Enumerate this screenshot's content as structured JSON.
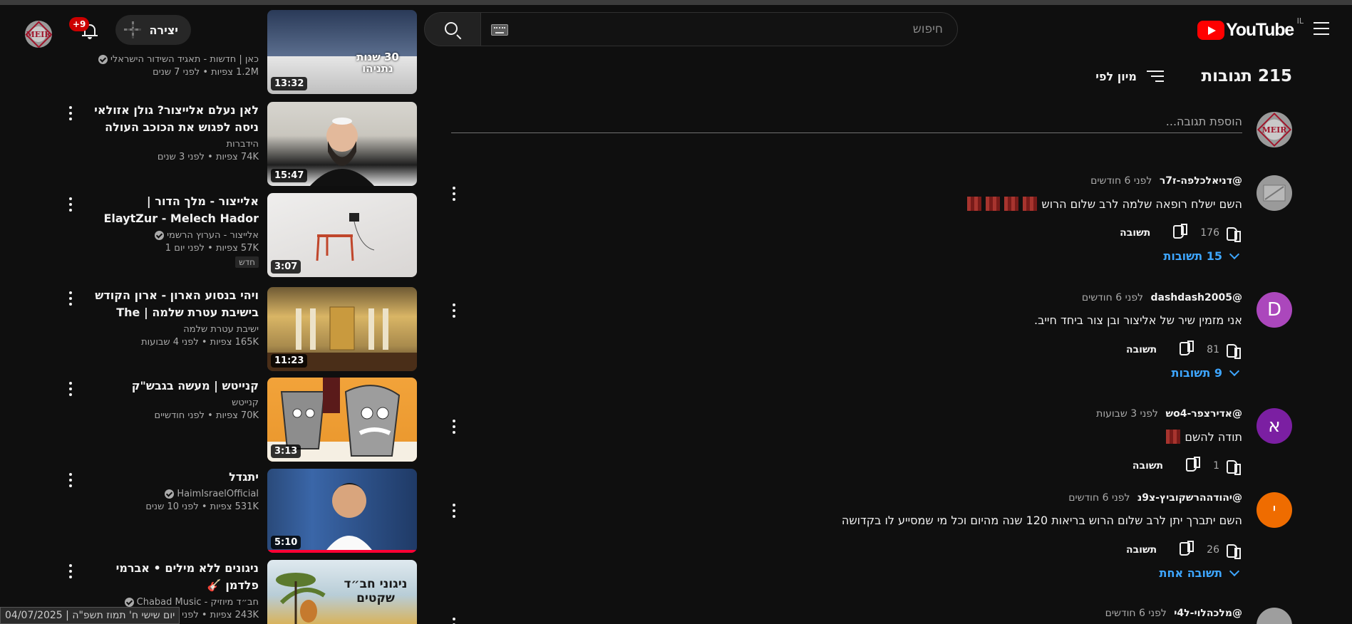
{
  "header": {
    "logo_text": "YouTube",
    "country_code": "IL",
    "search_placeholder": "חיפוש",
    "create_label": "יצירה",
    "notifications_badge": "+9"
  },
  "comments": {
    "count_label": "215 תגובות",
    "sort_label": "מיון לפי",
    "add_placeholder": "הוספת תגובה...",
    "reply_label": "תשובה",
    "items": [
      {
        "author": "@דניאלכלפה-ז7ר",
        "time": "לפני 6 חודשים",
        "text": "השם ישלח רופאה שלמה לרב שלום הרוש",
        "likes": "176",
        "replies": "15 תשובות",
        "avatar_letter": "",
        "avatar_color": "#9a9a9a"
      },
      {
        "author": "@dashdash2005",
        "time": "לפני 6 חודשים",
        "text": "אני מזמין שיר של אליצור ובן צור ביחד חייב.",
        "likes": "81",
        "replies": "9 תשובות",
        "avatar_letter": "D",
        "avatar_color": "#ab47bc"
      },
      {
        "author": "@אדירצפר-o4ש",
        "time": "לפני 3 שבועות",
        "text": "תודה להשם",
        "likes": "1",
        "replies": "",
        "avatar_letter": "א",
        "avatar_color": "#7b1fa2"
      },
      {
        "author": "@יהודההרשקוביץ-צ9נ",
        "time": "לפני 6 חודשים",
        "text": "השם יתברך יתן לרב שלום הרוש בריאות 120 שנה מהיום וכל מי שמסייע לו בקדושה",
        "likes": "26",
        "replies": "תשובה אחת",
        "avatar_letter": "י",
        "avatar_color": "#ef6c00"
      },
      {
        "author": "@מלכהלוי-ל4י",
        "time": "לפני 6 חודשים",
        "text": "",
        "likes": "",
        "replies": "",
        "avatar_letter": "",
        "avatar_color": "#9e9e9e"
      }
    ]
  },
  "related": [
    {
      "title": "",
      "channel": "כאן | חדשות - תאגיד השידור הישראלי",
      "verified": true,
      "stats": "1.2M צפיות • לפני 7 שנים",
      "duration": "13:32",
      "thumb_text": "30 שנות נתניהו",
      "is_new": false
    },
    {
      "title": "לאן נעלם אלייצור? גולן אזולאי ניסה לפגוש את הכוכב העולה",
      "channel": "הידברות",
      "verified": false,
      "stats": "74K צפיות • לפני 3 שנים",
      "duration": "15:47",
      "thumb_text": "",
      "is_new": false
    },
    {
      "title": "אלייצור - מלך הדור | ElaytZur - Melech Hador",
      "channel": "אלייצור - הערוץ הרשמי",
      "verified": true,
      "stats": "57K צפיות • לפני יום 1",
      "duration": "3:07",
      "thumb_text": "",
      "is_new": true,
      "new_label": "חדש"
    },
    {
      "title": "ויהי בנסוע הארון - ארון הקודש בישיבת עטרת שלמה | The Aron...",
      "channel": "ישיבת עטרת שלמה",
      "verified": false,
      "stats": "165K צפיות • לפני 4 שבועות",
      "duration": "11:23",
      "thumb_text": "",
      "is_new": false
    },
    {
      "title": "קנייטש | מעשה בגבש\"ק",
      "channel": "קנייטש",
      "verified": false,
      "stats": "70K צפיות • לפני חודשיים",
      "duration": "3:13",
      "thumb_text": "",
      "is_new": false
    },
    {
      "title": "יתגדל",
      "channel": "HaimIsraelOfficial",
      "verified": true,
      "stats": "531K צפיות • לפני 10 שנים",
      "duration": "5:10",
      "thumb_text": "",
      "is_new": false
    },
    {
      "title": "ניגונים ללא מילים • אברמי פלדמן 🎸",
      "channel": "חב״ד מיוזיק - Chabad Music",
      "verified": true,
      "stats": "243K צפיות • לפני שנה",
      "duration": "",
      "thumb_text": "ניגוני חב״ד שקטים",
      "is_new": false
    }
  ],
  "status_bar": "יום שישי ח' תמוז תשפ\"ה | 04/07/2025",
  "colors": {
    "accent_red": "#ff0000",
    "link_blue": "#3ea6ff",
    "background": "#0f0f0f"
  }
}
